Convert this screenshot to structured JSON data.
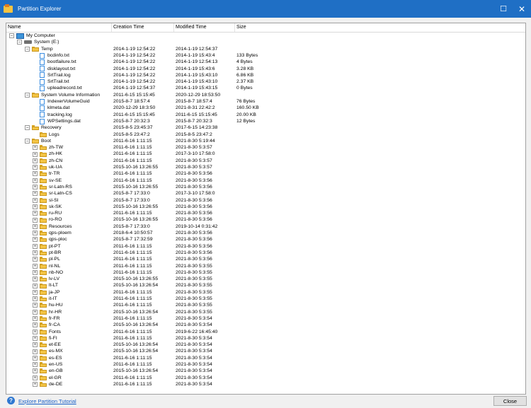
{
  "window": {
    "title": "Partition Explorer"
  },
  "columns": {
    "name": "Name",
    "creation": "Creation Time",
    "modified": "Modified Time",
    "size": "Size"
  },
  "rows": [
    {
      "indent": 0,
      "exp": "-",
      "icon": "computer",
      "name": "My Computer",
      "created": "",
      "modified": "",
      "size": ""
    },
    {
      "indent": 1,
      "exp": "-",
      "icon": "drive",
      "name": "System (E:)",
      "created": "",
      "modified": "",
      "size": ""
    },
    {
      "indent": 2,
      "exp": "-",
      "icon": "folder",
      "name": "Temp",
      "created": "2014-1-19 12:54:22",
      "modified": "2014-1-19 12:54:37",
      "size": ""
    },
    {
      "indent": 3,
      "exp": "",
      "icon": "file",
      "name": "bcdinfo.txt",
      "created": "2014-1-19 12:54:22",
      "modified": "2014-1-19 15:43:4",
      "size": "133 Bytes"
    },
    {
      "indent": 3,
      "exp": "",
      "icon": "file",
      "name": "bootfailure.txt",
      "created": "2014-1-19 12:54:22",
      "modified": "2014-1-19 12:54:13",
      "size": "4 Bytes"
    },
    {
      "indent": 3,
      "exp": "",
      "icon": "file",
      "name": "disklayout.txt",
      "created": "2014-1-19 12:54:22",
      "modified": "2014-1-19 15:43:6",
      "size": "3.28 KB"
    },
    {
      "indent": 3,
      "exp": "",
      "icon": "file",
      "name": "SrtTrail.log",
      "created": "2014-1-19 12:54:22",
      "modified": "2014-1-19 15:43:10",
      "size": "6.86 KB"
    },
    {
      "indent": 3,
      "exp": "",
      "icon": "file",
      "name": "SrtTrail.txt",
      "created": "2014-1-19 12:54:22",
      "modified": "2014-1-19 15:43:10",
      "size": "2.37 KB"
    },
    {
      "indent": 3,
      "exp": "",
      "icon": "file",
      "name": "upleadrecord.txt",
      "created": "2014-1-19 12:54:37",
      "modified": "2014-1-19 15:43:15",
      "size": "0 Bytes"
    },
    {
      "indent": 2,
      "exp": "-",
      "icon": "folder",
      "name": "System Volume Information",
      "created": "2011-6-15 15:15:45",
      "modified": "2020-12-29 18:53:50",
      "size": ""
    },
    {
      "indent": 3,
      "exp": "",
      "icon": "file",
      "name": "IndexerVolumeGuid",
      "created": "2015-8-7 18:57:4",
      "modified": "2015-8-7 18:57:4",
      "size": "76 Bytes"
    },
    {
      "indent": 3,
      "exp": "",
      "icon": "file",
      "name": "klmeta.dat",
      "created": "2020-12-29 18:3:50",
      "modified": "2021-8-31 22:42:2",
      "size": "160.50 KB"
    },
    {
      "indent": 3,
      "exp": "",
      "icon": "file",
      "name": "tracking.log",
      "created": "2011-6-15 15:15:45",
      "modified": "2011-6-15 15:15:45",
      "size": "20.00 KB"
    },
    {
      "indent": 3,
      "exp": "",
      "icon": "file",
      "name": "WPSettings.dat",
      "created": "2015-8-7 20:32:3",
      "modified": "2015-8-7 20:32:3",
      "size": "12 Bytes"
    },
    {
      "indent": 2,
      "exp": "-",
      "icon": "folder",
      "name": "Recovery",
      "created": "2015-8-5 23:45:37",
      "modified": "2017-6-15 14:23:38",
      "size": ""
    },
    {
      "indent": 3,
      "exp": "",
      "icon": "folder",
      "name": "Logs",
      "created": "2015-8-5 23:47:2",
      "modified": "2015-8-5 23:47:2",
      "size": ""
    },
    {
      "indent": 2,
      "exp": "-",
      "icon": "folder",
      "name": "Boot",
      "created": "2011-6-16 1:11:15",
      "modified": "2021-8-30 5:19:44",
      "size": ""
    },
    {
      "indent": 3,
      "exp": "+",
      "icon": "folder",
      "name": "zh-TW",
      "created": "2011-6-16 1:11:15",
      "modified": "2021-8-30 5:3:57",
      "size": ""
    },
    {
      "indent": 3,
      "exp": "+",
      "icon": "folder",
      "name": "zh-HK",
      "created": "2011-6-16 1:11:15",
      "modified": "2017-3-10 17:58:0",
      "size": ""
    },
    {
      "indent": 3,
      "exp": "+",
      "icon": "folder",
      "name": "zh-CN",
      "created": "2011-6-16 1:11:15",
      "modified": "2021-8-30 5:3:57",
      "size": ""
    },
    {
      "indent": 3,
      "exp": "+",
      "icon": "folder",
      "name": "uk-UA",
      "created": "2015-10-16 13:26:55",
      "modified": "2021-8-30 5:3:57",
      "size": ""
    },
    {
      "indent": 3,
      "exp": "+",
      "icon": "folder",
      "name": "tr-TR",
      "created": "2011-6-16 1:11:15",
      "modified": "2021-8-30 5:3:56",
      "size": ""
    },
    {
      "indent": 3,
      "exp": "+",
      "icon": "folder",
      "name": "sv-SE",
      "created": "2011-6-16 1:11:15",
      "modified": "2021-8-30 5:3:56",
      "size": ""
    },
    {
      "indent": 3,
      "exp": "+",
      "icon": "folder",
      "name": "sr-Latn-RS",
      "created": "2015-10-16 13:26:55",
      "modified": "2021-8-30 5:3:56",
      "size": ""
    },
    {
      "indent": 3,
      "exp": "+",
      "icon": "folder",
      "name": "sr-Latn-CS",
      "created": "2015-8-7 17:33:0",
      "modified": "2017-3-10 17:58:0",
      "size": ""
    },
    {
      "indent": 3,
      "exp": "+",
      "icon": "folder",
      "name": "sl-SI",
      "created": "2015-8-7 17:33:0",
      "modified": "2021-8-30 5:3:56",
      "size": ""
    },
    {
      "indent": 3,
      "exp": "+",
      "icon": "folder",
      "name": "sk-SK",
      "created": "2015-10-16 13:26:55",
      "modified": "2021-8-30 5:3:56",
      "size": ""
    },
    {
      "indent": 3,
      "exp": "+",
      "icon": "folder",
      "name": "ru-RU",
      "created": "2011-6-16 1:11:15",
      "modified": "2021-8-30 5:3:56",
      "size": ""
    },
    {
      "indent": 3,
      "exp": "+",
      "icon": "folder",
      "name": "ro-RO",
      "created": "2015-10-16 13:26:55",
      "modified": "2021-8-30 5:3:56",
      "size": ""
    },
    {
      "indent": 3,
      "exp": "+",
      "icon": "folder",
      "name": "Resources",
      "created": "2015-8-7 17:33:0",
      "modified": "2019-10-14 0:31:42",
      "size": ""
    },
    {
      "indent": 3,
      "exp": "+",
      "icon": "folder",
      "name": "qps-ploem",
      "created": "2018-6-4 10:50:57",
      "modified": "2021-8-30 5:3:56",
      "size": ""
    },
    {
      "indent": 3,
      "exp": "+",
      "icon": "folder",
      "name": "qps-ploc",
      "created": "2015-8-7 17:32:59",
      "modified": "2021-8-30 5:3:56",
      "size": ""
    },
    {
      "indent": 3,
      "exp": "+",
      "icon": "folder",
      "name": "pt-PT",
      "created": "2011-6-16 1:11:15",
      "modified": "2021-8-30 5:3:56",
      "size": ""
    },
    {
      "indent": 3,
      "exp": "+",
      "icon": "folder",
      "name": "pt-BR",
      "created": "2011-6-16 1:11:15",
      "modified": "2021-8-30 5:3:56",
      "size": ""
    },
    {
      "indent": 3,
      "exp": "+",
      "icon": "folder",
      "name": "pl-PL",
      "created": "2011-6-16 1:11:15",
      "modified": "2021-8-30 5:3:56",
      "size": ""
    },
    {
      "indent": 3,
      "exp": "+",
      "icon": "folder",
      "name": "nl-NL",
      "created": "2011-6-16 1:11:15",
      "modified": "2021-8-30 5:3:55",
      "size": ""
    },
    {
      "indent": 3,
      "exp": "+",
      "icon": "folder",
      "name": "nb-NO",
      "created": "2011-6-16 1:11:15",
      "modified": "2021-8-30 5:3:55",
      "size": ""
    },
    {
      "indent": 3,
      "exp": "+",
      "icon": "folder",
      "name": "lv-LV",
      "created": "2015-10-16 13:26:55",
      "modified": "2021-8-30 5:3:55",
      "size": ""
    },
    {
      "indent": 3,
      "exp": "+",
      "icon": "folder",
      "name": "lt-LT",
      "created": "2015-10-16 13:26:54",
      "modified": "2021-8-30 5:3:55",
      "size": ""
    },
    {
      "indent": 3,
      "exp": "+",
      "icon": "folder",
      "name": "ja-JP",
      "created": "2011-6-16 1:11:15",
      "modified": "2021-8-30 5:3:55",
      "size": ""
    },
    {
      "indent": 3,
      "exp": "+",
      "icon": "folder",
      "name": "it-IT",
      "created": "2011-6-16 1:11:15",
      "modified": "2021-8-30 5:3:55",
      "size": ""
    },
    {
      "indent": 3,
      "exp": "+",
      "icon": "folder",
      "name": "hu-HU",
      "created": "2011-6-16 1:11:15",
      "modified": "2021-8-30 5:3:55",
      "size": ""
    },
    {
      "indent": 3,
      "exp": "+",
      "icon": "folder",
      "name": "hr-HR",
      "created": "2015-10-16 13:26:54",
      "modified": "2021-8-30 5:3:55",
      "size": ""
    },
    {
      "indent": 3,
      "exp": "+",
      "icon": "folder",
      "name": "fr-FR",
      "created": "2011-6-16 1:11:15",
      "modified": "2021-8-30 5:3:54",
      "size": ""
    },
    {
      "indent": 3,
      "exp": "+",
      "icon": "folder",
      "name": "fr-CA",
      "created": "2015-10-16 13:26:54",
      "modified": "2021-8-30 5:3:54",
      "size": ""
    },
    {
      "indent": 3,
      "exp": "+",
      "icon": "folder",
      "name": "Fonts",
      "created": "2011-6-16 1:11:15",
      "modified": "2019-6-22 16:45:40",
      "size": ""
    },
    {
      "indent": 3,
      "exp": "+",
      "icon": "folder",
      "name": "fi-FI",
      "created": "2011-6-16 1:11:15",
      "modified": "2021-8-30 5:3:54",
      "size": ""
    },
    {
      "indent": 3,
      "exp": "+",
      "icon": "folder",
      "name": "et-EE",
      "created": "2015-10-16 13:26:54",
      "modified": "2021-8-30 5:3:54",
      "size": ""
    },
    {
      "indent": 3,
      "exp": "+",
      "icon": "folder",
      "name": "es-MX",
      "created": "2015-10-16 13:26:54",
      "modified": "2021-8-30 5:3:54",
      "size": ""
    },
    {
      "indent": 3,
      "exp": "+",
      "icon": "folder",
      "name": "es-ES",
      "created": "2011-6-16 1:11:15",
      "modified": "2021-8-30 5:3:54",
      "size": ""
    },
    {
      "indent": 3,
      "exp": "+",
      "icon": "folder",
      "name": "en-US",
      "created": "2011-6-16 1:11:15",
      "modified": "2021-8-30 5:3:54",
      "size": ""
    },
    {
      "indent": 3,
      "exp": "+",
      "icon": "folder",
      "name": "en-GB",
      "created": "2015-10-16 13:26:54",
      "modified": "2021-8-30 5:3:54",
      "size": ""
    },
    {
      "indent": 3,
      "exp": "+",
      "icon": "folder",
      "name": "el-GR",
      "created": "2011-6-16 1:11:15",
      "modified": "2021-8-30 5:3:54",
      "size": ""
    },
    {
      "indent": 3,
      "exp": "+",
      "icon": "folder",
      "name": "de-DE",
      "created": "2011-6-16 1:11:15",
      "modified": "2021-8-30 5:3:54",
      "size": ""
    }
  ],
  "footer": {
    "tutorial_link": "Explore Partition Tutorial",
    "close_label": "Close"
  },
  "colors": {
    "titlebar": "#1f6fc5",
    "link": "#1a62c9"
  }
}
